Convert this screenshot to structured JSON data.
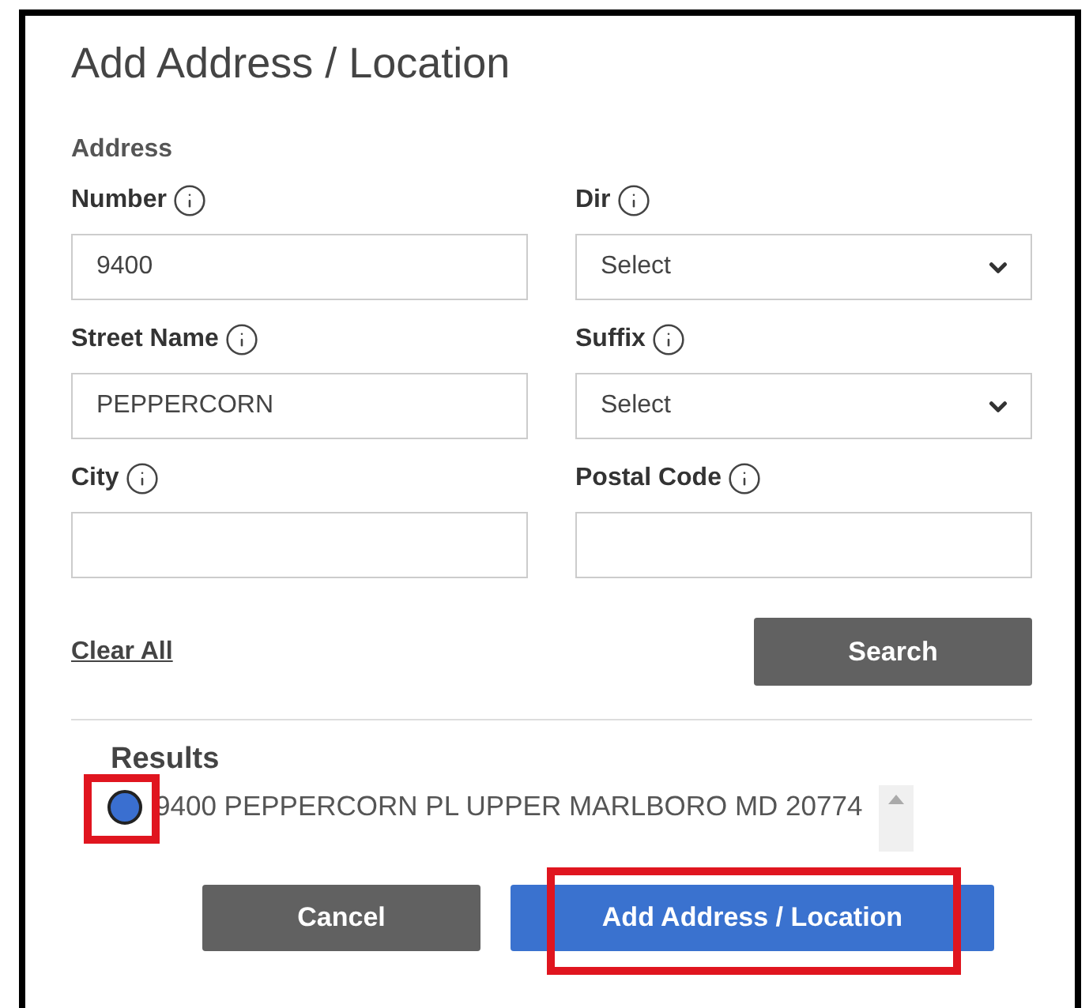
{
  "dialog": {
    "title": "Add Address / Location",
    "section_label": "Address",
    "fields": [
      {
        "label": "Number",
        "kind": "text",
        "value": "9400"
      },
      {
        "label": "Dir",
        "kind": "select",
        "value": "Select"
      },
      {
        "label": "Street Name",
        "kind": "text",
        "value": "PEPPERCORN"
      },
      {
        "label": "Suffix",
        "kind": "select",
        "value": "Select"
      },
      {
        "label": "City",
        "kind": "text"
      },
      {
        "label": "Postal Code",
        "kind": "text"
      }
    ],
    "clear_link": "Clear All",
    "search_button": "Search",
    "results": {
      "heading": "Results",
      "items": [
        {
          "text": "9400 PEPPERCORN PL UPPER MARLBORO MD 20774",
          "selected": true,
          "highlighted": true
        }
      ]
    },
    "buttons": [
      {
        "label": "Cancel",
        "kind": "secondary",
        "highlighted": false
      },
      {
        "label": "Add Address / Location",
        "kind": "primary",
        "highlighted": true
      }
    ]
  }
}
